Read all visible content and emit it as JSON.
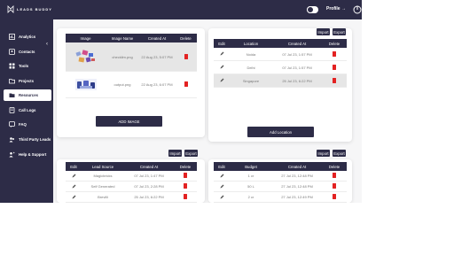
{
  "brand": {
    "name": "LEADS BUDDY"
  },
  "header": {
    "profile_label": "Profile →"
  },
  "sidebar": {
    "items": [
      {
        "label": "Analytics",
        "icon": "analytics-icon"
      },
      {
        "label": "Contacts",
        "icon": "contacts-icon"
      },
      {
        "label": "Tools",
        "icon": "tools-icon"
      },
      {
        "label": "Projects",
        "icon": "projects-icon"
      },
      {
        "label": "Resources",
        "icon": "resources-icon"
      },
      {
        "label": "Call Logs",
        "icon": "call-logs-icon"
      },
      {
        "label": "FAQ",
        "icon": "faq-icon"
      },
      {
        "label": "Third Party Leads",
        "icon": "third-party-icon"
      },
      {
        "label": "Help & Support",
        "icon": "help-icon"
      }
    ],
    "active_index": 4
  },
  "images_card": {
    "columns": [
      "Image",
      "Image Name",
      "Created At",
      "Delete"
    ],
    "rows": [
      {
        "name": "checklim.png",
        "created": "22 Aug 23, 5:07 PM"
      },
      {
        "name": "output.png",
        "created": "22 Aug 23, 6:07 PM"
      }
    ],
    "button": "ADD IMAGE"
  },
  "locations_card": {
    "import": "Import",
    "export": "Export",
    "columns": [
      "Edit",
      "Location",
      "Created At",
      "Delete"
    ],
    "rows": [
      {
        "location": "Noida",
        "created": "07 Jul 23, 1:57 PM"
      },
      {
        "location": "Delhi",
        "created": "07 Jul 23, 1:57 PM"
      },
      {
        "location": "Singapore",
        "created": "25 Jul 23, 6:22 PM"
      }
    ],
    "button": "Add Location"
  },
  "sources_card": {
    "import": "Import",
    "export": "Export",
    "columns": [
      "Edit",
      "Lead Source",
      "Created At",
      "Delete"
    ],
    "rows": [
      {
        "source": "Magicbricks",
        "created": "07 Jul 23, 1:47 PM"
      },
      {
        "source": "Self Generated",
        "created": "07 Jul 23, 2:28 PM"
      },
      {
        "source": "Brevilli",
        "created": "25 Jul 23, 6:22 PM"
      }
    ]
  },
  "budgets_card": {
    "import": "Import",
    "export": "Export",
    "columns": [
      "Edit",
      "Budget",
      "Created At",
      "Delete"
    ],
    "rows": [
      {
        "budget": "1 cr",
        "created": "27 Jul 23, 12:48 PM"
      },
      {
        "budget": "50 L",
        "created": "27 Jul 23, 12:48 PM"
      },
      {
        "budget": "2 cr",
        "created": "27 Jul 23, 12:49 PM"
      }
    ]
  },
  "colors": {
    "primary": "#2d2c47",
    "delete": "#e32222",
    "background": "#f6f6f7"
  }
}
